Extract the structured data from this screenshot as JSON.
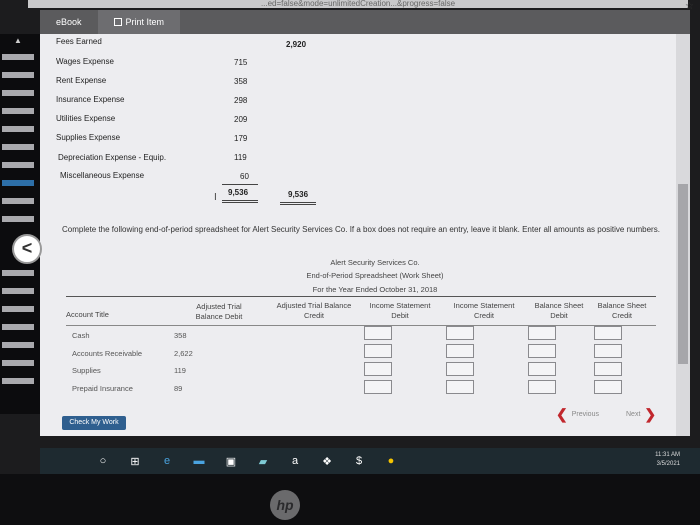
{
  "browser": {
    "url_fragment": "...ed=false&mode=unlimitedCreation...&progress=false"
  },
  "tabs": [
    {
      "label": "eBook"
    },
    {
      "label": "Print Item"
    }
  ],
  "trial_balance": {
    "rows": [
      {
        "title": "Fees Earned",
        "debit": "",
        "credit": "2,920"
      },
      {
        "title": "Wages Expense",
        "debit": "715",
        "credit": ""
      },
      {
        "title": "Rent Expense",
        "debit": "358",
        "credit": ""
      },
      {
        "title": "Insurance Expense",
        "debit": "298",
        "credit": ""
      },
      {
        "title": "Utilities Expense",
        "debit": "209",
        "credit": ""
      },
      {
        "title": "Supplies Expense",
        "debit": "179",
        "credit": ""
      },
      {
        "title": "Depreciation Expense - Equip.",
        "debit": "119",
        "credit": ""
      },
      {
        "title": "Miscellaneous Expense",
        "debit": "60",
        "credit": ""
      }
    ],
    "total_debit": "9,536",
    "total_credit": "9,536"
  },
  "instructions": "Complete the following end-of-period spreadsheet for Alert Security Services Co. If a box does not require an entry, leave it blank. Enter all amounts as positive numbers.",
  "spreadsheet": {
    "company": "Alert Security Services Co.",
    "title": "End-of-Period Spreadsheet (Work Sheet)",
    "period": "For the Year Ended October 31, 2018",
    "columns": {
      "account": "Account Title",
      "tb_debit": "Adjusted Trial Balance Debit",
      "atb_credit": "Adjusted Trial Balance Credit",
      "is_debit": "Income Statement Debit",
      "is_credit": "Income Statement Credit",
      "bs_debit": "Balance Sheet Debit",
      "bs_credit": "Balance Sheet Credit"
    },
    "rows": [
      {
        "title": "Cash",
        "value": "358"
      },
      {
        "title": "Accounts Receivable",
        "value": "2,622"
      },
      {
        "title": "Supplies",
        "value": "119"
      },
      {
        "title": "Prepaid Insurance",
        "value": "89"
      }
    ]
  },
  "buttons": {
    "check": "Check My Work",
    "previous": "Previous",
    "next": "Next"
  },
  "system_tray": {
    "time": "11:31 AM",
    "date": "3/5/2021"
  },
  "device_logo": "hp"
}
